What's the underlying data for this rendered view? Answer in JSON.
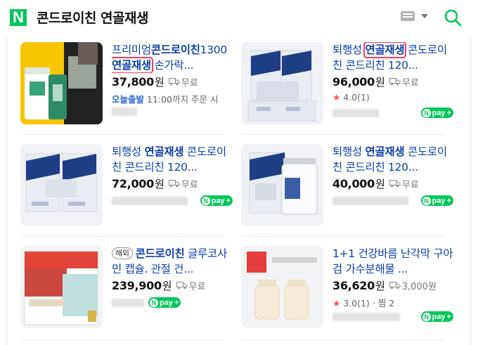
{
  "header": {
    "logo_text": "N",
    "query": "콘드로이친 연골재생",
    "icons": [
      "keyboard-icon",
      "chevron-down-icon",
      "search-icon"
    ],
    "brand_color": "#03c75a"
  },
  "products": [
    {
      "title_parts": [
        "프리미엄",
        "콘드로이친",
        "1300 ",
        "연골재생",
        " 손가락..."
      ],
      "price": "37,800",
      "won": "원",
      "shipping": "무료",
      "meta_blue": "오늘출발",
      "meta_text": " 11:00까지 주문 시",
      "npay": false
    },
    {
      "title_parts": [
        "퇴행성 ",
        "연골재생",
        " 콘도로이친 콘드리친 120..."
      ],
      "price": "96,000",
      "won": "원",
      "shipping": "무료",
      "rating": "4.0",
      "reviews": "(1)",
      "npay": true
    },
    {
      "title_parts": [
        "퇴행성 ",
        "연골재생",
        " 콘도로이친 콘드리친 120..."
      ],
      "price": "72,000",
      "won": "원",
      "shipping": "무료",
      "npay": true
    },
    {
      "title_parts": [
        "퇴행성 ",
        "연골재생",
        " 콘도로이친 콘드리친 120..."
      ],
      "price": "40,000",
      "won": "원",
      "shipping": "무료",
      "npay": true
    },
    {
      "badge": "해외",
      "title_parts": [
        "콘드로이친",
        " 글루코사민 캡슐. 관절 건..."
      ],
      "price": "239,900",
      "won": "원",
      "shipping": "무료",
      "npay": true
    },
    {
      "title_parts": [
        "1+1 건강바름 난각막 구아검 가수분해물 ..."
      ],
      "price": "36,620",
      "won": "원",
      "shipping": "3,000원",
      "rating": "3.0",
      "reviews": "(1)",
      "zzim": "· 찜 2",
      "npay": true
    }
  ],
  "npay_label": "pay",
  "npay_n": "N",
  "npay_plus": "+",
  "colors": {
    "link": "#0c3fa8",
    "highlight_box": "#ff3b57",
    "star": "#ff4f4f",
    "npay": "#03c75a",
    "today": "#2a62d6"
  }
}
